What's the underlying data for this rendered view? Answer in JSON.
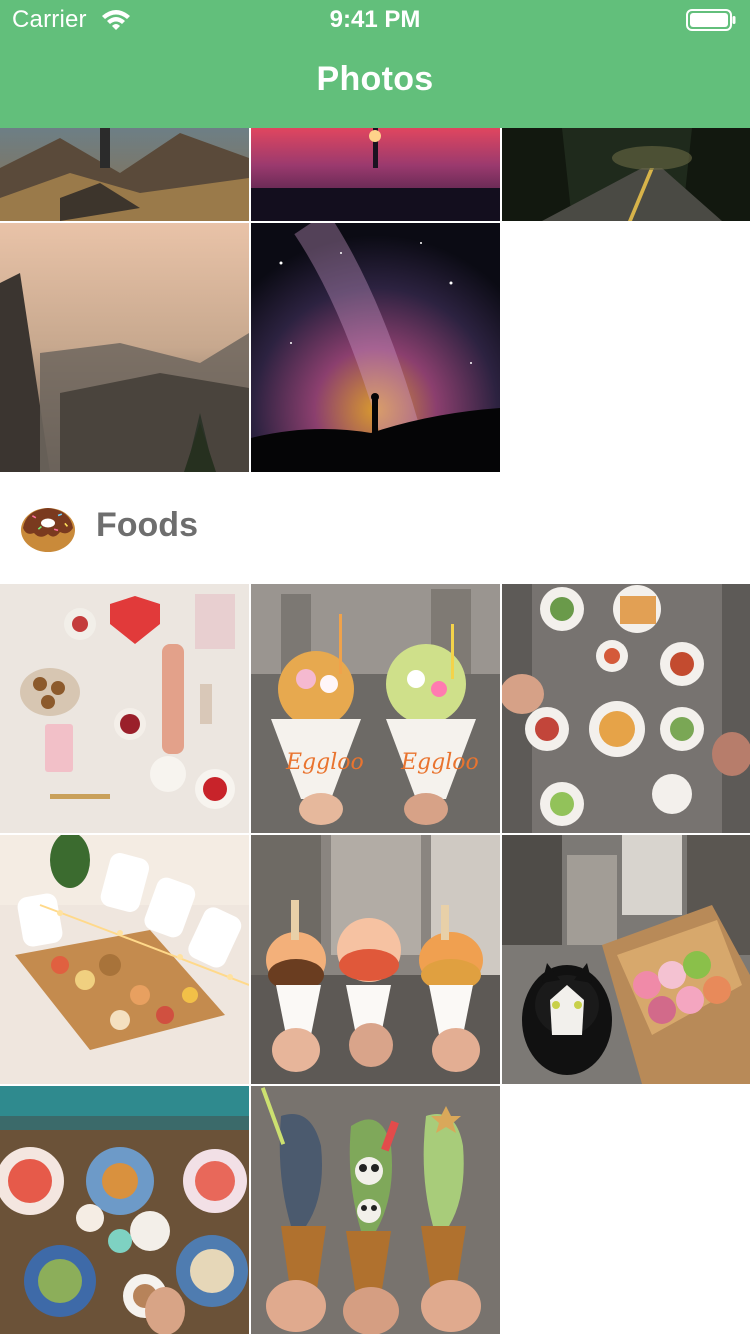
{
  "status_bar": {
    "carrier": "Carrier",
    "time": "9:41 PM",
    "wifi_icon": "wifi-icon",
    "battery_icon": "battery-icon"
  },
  "nav": {
    "title": "Photos",
    "background_color": "#62bf7b"
  },
  "sections": [
    {
      "id": "landscapes",
      "header_visible": false,
      "photos": [
        {
          "subject": "hiker on mountain ridge"
        },
        {
          "subject": "tree silhouette at sunset over water"
        },
        {
          "subject": "forest road at dusk"
        },
        {
          "subject": "misty valley cliffs"
        },
        {
          "subject": "milky way with silhouette"
        }
      ]
    },
    {
      "id": "foods",
      "title": "Foods",
      "icon": "donut-icon",
      "photos": [
        {
          "subject": "flat lay of food and accessories"
        },
        {
          "subject": "egg waffle ice cream cones"
        },
        {
          "subject": "brunch table spread"
        },
        {
          "subject": "picnic board with fairy lights"
        },
        {
          "subject": "three soft serve cones on street"
        },
        {
          "subject": "cat with box of donuts"
        },
        {
          "subject": "brunch plates on wooden table"
        },
        {
          "subject": "fish-shaped ice cream cones"
        }
      ]
    }
  ]
}
